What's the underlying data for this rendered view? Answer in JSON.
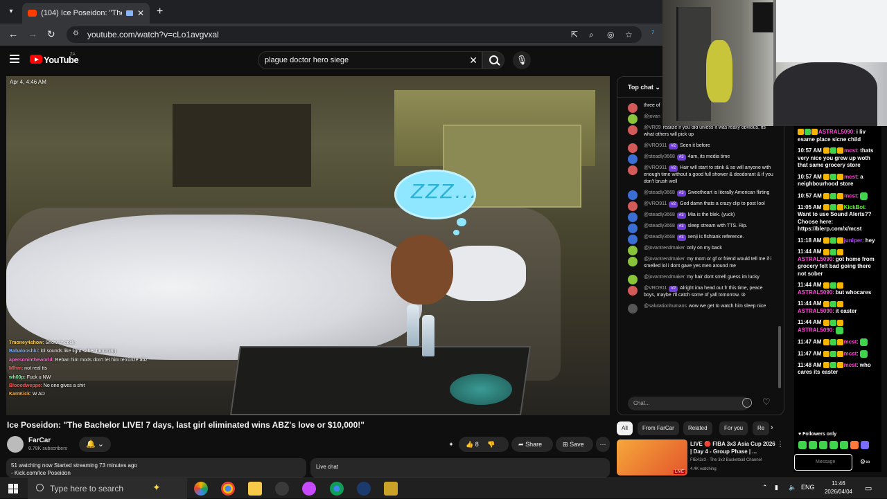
{
  "browser": {
    "tab_title": "(104) Ice Poseidon: \"The Ba",
    "new_tab": "+",
    "url": "youtube.com/watch?v=cLo1avgvxal"
  },
  "youtube": {
    "logo_text": "YouTube",
    "country": "ZA",
    "search_query": "plague doctor hero siege"
  },
  "video": {
    "timestamp": "Apr 4, 4:46 AM",
    "bubble_text": "ZZZ...",
    "overlay_chat": [
      {
        "user": "Tmoney4show",
        "msg": "Show ur cock",
        "color": "#ffd24a"
      },
      {
        "user": "Babalooshki",
        "msg": "lol sounds like light saber humming",
        "color": "#7fb0ff"
      },
      {
        "user": "apersonintheworld",
        "msg": "Reban him mods don't let him terrorize abz",
        "color": "#ff6bd0"
      },
      {
        "user": "Mlhm",
        "msg": "not real tts",
        "color": "#ff6b6b"
      },
      {
        "user": "wh00p",
        "msg": "Fuck u NW",
        "color": "#6bff9c"
      },
      {
        "user": "Blooodweppe",
        "msg": "No one gives a shit",
        "color": "#ff5a5a"
      },
      {
        "user": "KamKick",
        "msg": "W AD",
        "color": "#ffb34a"
      }
    ]
  },
  "below_video": {
    "title": "Ice Poseidon: \"The Bachelor LIVE! 7 days, last girl eliminated wins ABZ's love or $10,000!\"",
    "channel_name": "FarCar",
    "subscribers": "8.78K subscribers",
    "likes": "8",
    "share_label": "Share",
    "save_label": "Save",
    "desc_line1": "51 watching now  Started streaming 73 minutes ago",
    "desc_line2": "- Kick.com/Ice Poseidon",
    "live_chat_label": "Live chat"
  },
  "live_chat": {
    "mode": "Top chat",
    "input_placeholder": "Chat...",
    "messages": [
      {
        "author": "",
        "badge": "",
        "text": "three of",
        "avatar": "#d45a5a"
      },
      {
        "author": "@jovan",
        "badge": "",
        "text": "",
        "avatar": "#8ac43a"
      },
      {
        "author": "@VR09",
        "badge": "",
        "text": "realize if you did unless it was really obvious, its what others will pick up",
        "avatar": "#d45a5a"
      },
      {
        "author": "@VRO911",
        "badge": "#2",
        "text": "Seen it before",
        "avatar": "#d45a5a"
      },
      {
        "author": "@steadly3668",
        "badge": "#3",
        "text": "4am, its media time",
        "avatar": "#3a6ed4"
      },
      {
        "author": "@VRO911",
        "badge": "#2",
        "text": "Hair will start to stink & so will anyone with enough time without a good full shower & deodorant & if you don't brush well",
        "avatar": "#d45a5a"
      },
      {
        "author": "@steadly3668",
        "badge": "#3",
        "text": "Sweetheart is literally American flirting",
        "avatar": "#3a6ed4"
      },
      {
        "author": "@VRO911",
        "badge": "#2",
        "text": "God damn thats a crazy clip to post lool",
        "avatar": "#d45a5a"
      },
      {
        "author": "@steadly3668",
        "badge": "#3",
        "text": "Mia is the blek. (yuck)",
        "avatar": "#3a6ed4"
      },
      {
        "author": "@steadly3668",
        "badge": "#3",
        "text": "sleep stream with TTS. Rip.",
        "avatar": "#3a6ed4"
      },
      {
        "author": "@steadly3668",
        "badge": "#3",
        "text": "xenji is fishtank reference.",
        "avatar": "#3a6ed4"
      },
      {
        "author": "@jovantrendmaker",
        "badge": "",
        "text": "only on my back",
        "avatar": "#8ac43a"
      },
      {
        "author": "@jovantrendmaker",
        "badge": "",
        "text": "my mom or gf or friend would tell me if i smelled lol i dont gave yes men around me",
        "avatar": "#8ac43a"
      },
      {
        "author": "@jovantrendmaker",
        "badge": "",
        "text": "my hair dont smell guess im lucky",
        "avatar": "#8ac43a"
      },
      {
        "author": "@VRO911",
        "badge": "#2",
        "text": "Alright ima head out fr this time, peace boys, maybe I'll catch some of yall tomorrow. ☮",
        "avatar": "#d45a5a"
      },
      {
        "author": "@salutationhumans",
        "badge": "",
        "text": "wow we get to watch him sleep nice",
        "avatar": "#555555"
      }
    ]
  },
  "chips": [
    "All",
    "From FarCar",
    "Related",
    "For you",
    "Re"
  ],
  "recommended": {
    "title": "LIVE 🔴 FIBA 3x3 Asia Cup 2026 | Day 4 - Group Phase | ...",
    "channel": "FIBA3x3 - The 3x3 Basketball Channel",
    "watching": "4.4K watching",
    "live_tag": "LIVE"
  },
  "kick_chat": {
    "messages": [
      {
        "time": "",
        "name": "ASTRAL5090",
        "name_color": "#ff4ad6",
        "text": "i liv esame place sicne child"
      },
      {
        "time": "10:57 AM",
        "name": "mcst",
        "name_color": "#ff4ad6",
        "text": "thats very nice you grew up woth that same grocery store"
      },
      {
        "time": "10:57 AM",
        "name": "mcst",
        "name_color": "#ff4ad6",
        "text": "a neighbourhood store"
      },
      {
        "time": "10:57 AM",
        "name": "mcst",
        "name_color": "#ff4ad6",
        "text": ""
      },
      {
        "time": "11:05 AM",
        "name": "KickBot",
        "name_color": "#53fc18",
        "text": "Want to use Sound Alerts?? Choose here: https://blerp.com/x/mcst"
      },
      {
        "time": "11:18 AM",
        "name": "juniper",
        "name_color": "#b44aff",
        "text": "hey"
      },
      {
        "time": "11:44 AM",
        "name": "ASTRAL5090",
        "name_color": "#ff4ad6",
        "text": "got home from grocery felt bad going there not sober"
      },
      {
        "time": "11:44 AM",
        "name": "ASTRAL5090",
        "name_color": "#ff4ad6",
        "text": "but whocares"
      },
      {
        "time": "11:44 AM",
        "name": "ASTRAL5090",
        "name_color": "#ff4ad6",
        "text": "it easter"
      },
      {
        "time": "11:44 AM",
        "name": "ASTRAL5090",
        "name_color": "#ff4ad6",
        "text": ""
      },
      {
        "time": "11:47 AM",
        "name": "mcst",
        "name_color": "#ff4ad6",
        "text": ""
      },
      {
        "time": "11:47 AM",
        "name": "mcst",
        "name_color": "#ff4ad6",
        "text": ""
      },
      {
        "time": "11:48 AM",
        "name": "mcst",
        "name_color": "#ff4ad6",
        "text": "who cares its easter"
      }
    ],
    "followers_only": "Followers only",
    "input_placeholder": "Message"
  },
  "taskbar": {
    "search_placeholder": "Type here to search",
    "language": "ENG",
    "time": "11:46",
    "date": "2026/04/04"
  }
}
